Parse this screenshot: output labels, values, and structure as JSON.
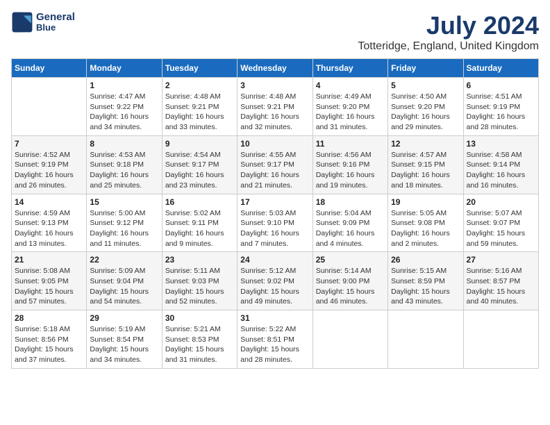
{
  "header": {
    "logo_line1": "General",
    "logo_line2": "Blue",
    "month": "July 2024",
    "location": "Totteridge, England, United Kingdom"
  },
  "weekdays": [
    "Sunday",
    "Monday",
    "Tuesday",
    "Wednesday",
    "Thursday",
    "Friday",
    "Saturday"
  ],
  "weeks": [
    [
      {
        "day": "",
        "info": ""
      },
      {
        "day": "1",
        "info": "Sunrise: 4:47 AM\nSunset: 9:22 PM\nDaylight: 16 hours\nand 34 minutes."
      },
      {
        "day": "2",
        "info": "Sunrise: 4:48 AM\nSunset: 9:21 PM\nDaylight: 16 hours\nand 33 minutes."
      },
      {
        "day": "3",
        "info": "Sunrise: 4:48 AM\nSunset: 9:21 PM\nDaylight: 16 hours\nand 32 minutes."
      },
      {
        "day": "4",
        "info": "Sunrise: 4:49 AM\nSunset: 9:20 PM\nDaylight: 16 hours\nand 31 minutes."
      },
      {
        "day": "5",
        "info": "Sunrise: 4:50 AM\nSunset: 9:20 PM\nDaylight: 16 hours\nand 29 minutes."
      },
      {
        "day": "6",
        "info": "Sunrise: 4:51 AM\nSunset: 9:19 PM\nDaylight: 16 hours\nand 28 minutes."
      }
    ],
    [
      {
        "day": "7",
        "info": "Sunrise: 4:52 AM\nSunset: 9:19 PM\nDaylight: 16 hours\nand 26 minutes."
      },
      {
        "day": "8",
        "info": "Sunrise: 4:53 AM\nSunset: 9:18 PM\nDaylight: 16 hours\nand 25 minutes."
      },
      {
        "day": "9",
        "info": "Sunrise: 4:54 AM\nSunset: 9:17 PM\nDaylight: 16 hours\nand 23 minutes."
      },
      {
        "day": "10",
        "info": "Sunrise: 4:55 AM\nSunset: 9:17 PM\nDaylight: 16 hours\nand 21 minutes."
      },
      {
        "day": "11",
        "info": "Sunrise: 4:56 AM\nSunset: 9:16 PM\nDaylight: 16 hours\nand 19 minutes."
      },
      {
        "day": "12",
        "info": "Sunrise: 4:57 AM\nSunset: 9:15 PM\nDaylight: 16 hours\nand 18 minutes."
      },
      {
        "day": "13",
        "info": "Sunrise: 4:58 AM\nSunset: 9:14 PM\nDaylight: 16 hours\nand 16 minutes."
      }
    ],
    [
      {
        "day": "14",
        "info": "Sunrise: 4:59 AM\nSunset: 9:13 PM\nDaylight: 16 hours\nand 13 minutes."
      },
      {
        "day": "15",
        "info": "Sunrise: 5:00 AM\nSunset: 9:12 PM\nDaylight: 16 hours\nand 11 minutes."
      },
      {
        "day": "16",
        "info": "Sunrise: 5:02 AM\nSunset: 9:11 PM\nDaylight: 16 hours\nand 9 minutes."
      },
      {
        "day": "17",
        "info": "Sunrise: 5:03 AM\nSunset: 9:10 PM\nDaylight: 16 hours\nand 7 minutes."
      },
      {
        "day": "18",
        "info": "Sunrise: 5:04 AM\nSunset: 9:09 PM\nDaylight: 16 hours\nand 4 minutes."
      },
      {
        "day": "19",
        "info": "Sunrise: 5:05 AM\nSunset: 9:08 PM\nDaylight: 16 hours\nand 2 minutes."
      },
      {
        "day": "20",
        "info": "Sunrise: 5:07 AM\nSunset: 9:07 PM\nDaylight: 15 hours\nand 59 minutes."
      }
    ],
    [
      {
        "day": "21",
        "info": "Sunrise: 5:08 AM\nSunset: 9:05 PM\nDaylight: 15 hours\nand 57 minutes."
      },
      {
        "day": "22",
        "info": "Sunrise: 5:09 AM\nSunset: 9:04 PM\nDaylight: 15 hours\nand 54 minutes."
      },
      {
        "day": "23",
        "info": "Sunrise: 5:11 AM\nSunset: 9:03 PM\nDaylight: 15 hours\nand 52 minutes."
      },
      {
        "day": "24",
        "info": "Sunrise: 5:12 AM\nSunset: 9:02 PM\nDaylight: 15 hours\nand 49 minutes."
      },
      {
        "day": "25",
        "info": "Sunrise: 5:14 AM\nSunset: 9:00 PM\nDaylight: 15 hours\nand 46 minutes."
      },
      {
        "day": "26",
        "info": "Sunrise: 5:15 AM\nSunset: 8:59 PM\nDaylight: 15 hours\nand 43 minutes."
      },
      {
        "day": "27",
        "info": "Sunrise: 5:16 AM\nSunset: 8:57 PM\nDaylight: 15 hours\nand 40 minutes."
      }
    ],
    [
      {
        "day": "28",
        "info": "Sunrise: 5:18 AM\nSunset: 8:56 PM\nDaylight: 15 hours\nand 37 minutes."
      },
      {
        "day": "29",
        "info": "Sunrise: 5:19 AM\nSunset: 8:54 PM\nDaylight: 15 hours\nand 34 minutes."
      },
      {
        "day": "30",
        "info": "Sunrise: 5:21 AM\nSunset: 8:53 PM\nDaylight: 15 hours\nand 31 minutes."
      },
      {
        "day": "31",
        "info": "Sunrise: 5:22 AM\nSunset: 8:51 PM\nDaylight: 15 hours\nand 28 minutes."
      },
      {
        "day": "",
        "info": ""
      },
      {
        "day": "",
        "info": ""
      },
      {
        "day": "",
        "info": ""
      }
    ]
  ]
}
